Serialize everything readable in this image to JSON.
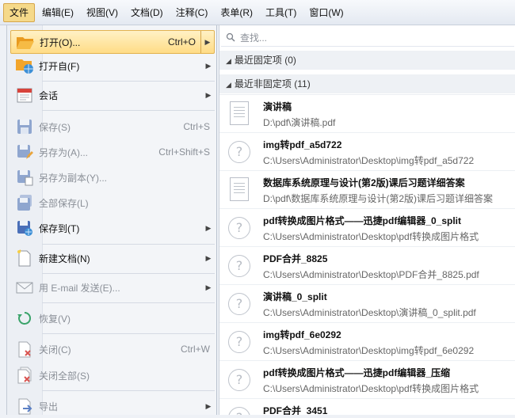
{
  "menubar": {
    "items": [
      {
        "label": "文件",
        "active": true
      },
      {
        "label": "编辑(E)"
      },
      {
        "label": "视图(V)"
      },
      {
        "label": "文档(D)"
      },
      {
        "label": "注释(C)"
      },
      {
        "label": "表单(R)"
      },
      {
        "label": "工具(T)"
      },
      {
        "label": "窗口(W)"
      }
    ]
  },
  "menu": {
    "items": [
      {
        "label": "打开(O)...",
        "shortcut": "Ctrl+O",
        "submenu": true,
        "icon": "folder-open-icon",
        "state": "highlighted"
      },
      {
        "label": "打开自(F)",
        "shortcut": "",
        "submenu": true,
        "icon": "folder-globe-icon"
      },
      {
        "label": "会话",
        "shortcut": "",
        "submenu": true,
        "icon": "calendar-icon"
      },
      {
        "label": "保存(S)",
        "shortcut": "Ctrl+S",
        "submenu": false,
        "icon": "save-icon",
        "state": "disabled"
      },
      {
        "label": "另存为(A)...",
        "shortcut": "Ctrl+Shift+S",
        "submenu": false,
        "icon": "save-as-icon",
        "state": "disabled"
      },
      {
        "label": "另存为副本(Y)...",
        "shortcut": "",
        "submenu": false,
        "icon": "save-copy-icon",
        "state": "disabled"
      },
      {
        "label": "全部保存(L)",
        "shortcut": "",
        "submenu": false,
        "icon": "save-all-icon",
        "state": "disabled"
      },
      {
        "label": "保存到(T)",
        "shortcut": "",
        "submenu": true,
        "icon": "save-to-icon"
      },
      {
        "label": "新建文档(N)",
        "shortcut": "",
        "submenu": true,
        "icon": "new-document-icon"
      },
      {
        "label": "用 E-mail 发送(E)...",
        "shortcut": "",
        "submenu": true,
        "icon": "email-icon",
        "state": "disabled"
      },
      {
        "label": "恢复(V)",
        "shortcut": "",
        "submenu": false,
        "icon": "restore-icon",
        "state": "disabled"
      },
      {
        "label": "关闭(C)",
        "shortcut": "Ctrl+W",
        "submenu": false,
        "icon": "close-document-icon",
        "state": "disabled"
      },
      {
        "label": "关闭全部(S)",
        "shortcut": "",
        "submenu": false,
        "icon": "close-all-icon",
        "state": "disabled"
      },
      {
        "label": "导出",
        "shortcut": "",
        "submenu": true,
        "icon": "export-icon",
        "state": "disabled"
      }
    ]
  },
  "recent": {
    "search_placeholder": "查找...",
    "pinned_header": "最近固定项 (0)",
    "unpinned_header": "最近非固定项 (11)",
    "files": [
      {
        "name": "演讲稿",
        "path": "D:\\pdf\\演讲稿.pdf",
        "icon": "document-icon"
      },
      {
        "name": "img转pdf_a5d722",
        "path": "C:\\Users\\Administrator\\Desktop\\img转pdf_a5d722",
        "icon": "unknown-file-icon"
      },
      {
        "name": "数据库系统原理与设计(第2版)课后习题详细答案",
        "path": "D:\\pdf\\数据库系统原理与设计(第2版)课后习题详细答案",
        "icon": "document-icon"
      },
      {
        "name": "pdf转换成图片格式——迅捷pdf编辑器_0_split",
        "path": "C:\\Users\\Administrator\\Desktop\\pdf转换成图片格式",
        "icon": "unknown-file-icon"
      },
      {
        "name": "PDF合并_8825",
        "path": "C:\\Users\\Administrator\\Desktop\\PDF合并_8825.pdf",
        "icon": "unknown-file-icon"
      },
      {
        "name": "演讲稿_0_split",
        "path": "C:\\Users\\Administrator\\Desktop\\演讲稿_0_split.pdf",
        "icon": "unknown-file-icon"
      },
      {
        "name": "img转pdf_6e0292",
        "path": "C:\\Users\\Administrator\\Desktop\\img转pdf_6e0292",
        "icon": "unknown-file-icon"
      },
      {
        "name": "pdf转换成图片格式——迅捷pdf编辑器_压缩",
        "path": "C:\\Users\\Administrator\\Desktop\\pdf转换成图片格式",
        "icon": "unknown-file-icon"
      },
      {
        "name": "PDF合并_3451",
        "path": "",
        "icon": "unknown-file-icon"
      }
    ]
  },
  "colors": {
    "highlight": "#ffdc86",
    "folder": "#f2a52c",
    "save_blue": "#5b7fc4"
  }
}
